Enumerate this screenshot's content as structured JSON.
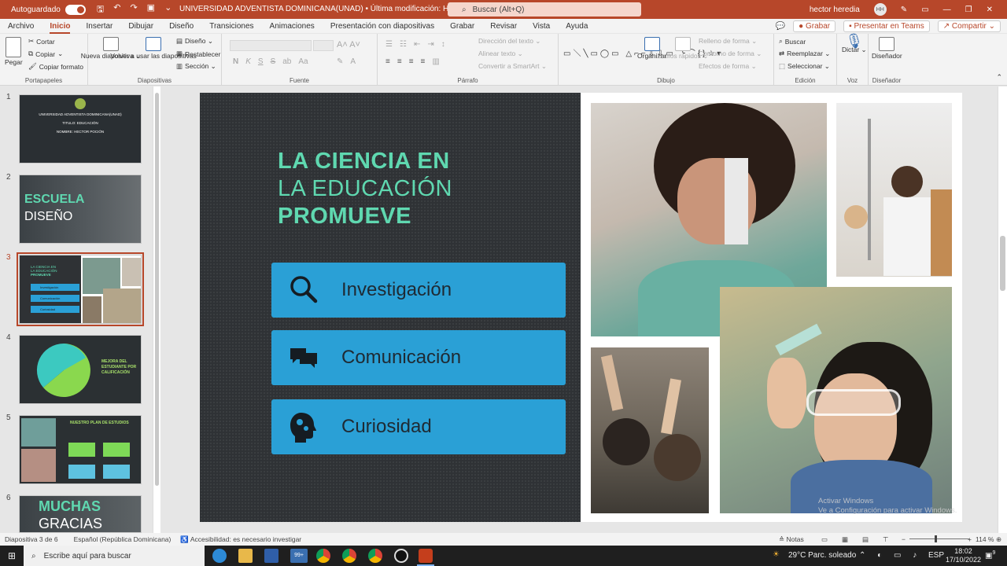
{
  "titlebar": {
    "autosave_label": "Autoguardado",
    "doc_title": "UNIVERSIDAD ADVENTISTA DOMINICANA(UNAD)  •  Última modificación: Hace 21 min ⌄",
    "search_placeholder": "Buscar (Alt+Q)",
    "user_name": "hector heredia",
    "user_initials": "HH"
  },
  "tabs": [
    "Archivo",
    "Inicio",
    "Insertar",
    "Dibujar",
    "Diseño",
    "Transiciones",
    "Animaciones",
    "Presentación con diapositivas",
    "Grabar",
    "Revisar",
    "Vista",
    "Ayuda"
  ],
  "active_tab": "Inicio",
  "tab_actions": {
    "grabar": "Grabar",
    "teams": "Presentar en Teams",
    "compartir": "Compartir"
  },
  "ribbon": {
    "portapapeles": {
      "label": "Portapapeles",
      "pegar": "Pegar",
      "cortar": "Cortar",
      "copiar": "Copiar",
      "copiar_formato": "Copiar formato"
    },
    "diapositivas": {
      "label": "Diapositivas",
      "nueva": "Nueva diapositiva ⌄",
      "volver": "Volver a usar las diapositivas",
      "diseno": "Diseño ⌄",
      "restablecer": "Restablecer",
      "seccion": "Sección ⌄"
    },
    "fuente": {
      "label": "Fuente"
    },
    "parrafo": {
      "label": "Párrafo",
      "direccion": "Dirección del texto ⌄",
      "alinear": "Alinear texto ⌄",
      "smartart": "Convertir a SmartArt ⌄"
    },
    "dibujo": {
      "label": "Dibujo",
      "organizar": "Organizar",
      "estilos": "Estilos rápidos ⌄",
      "relleno": "Relleno de forma ⌄",
      "contorno": "Contorno de forma ⌄",
      "efectos": "Efectos de forma ⌄"
    },
    "edicion": {
      "label": "Edición",
      "buscar": "Buscar",
      "reemplazar": "Reemplazar ⌄",
      "seleccionar": "Seleccionar ⌄"
    },
    "voz": {
      "label": "Voz",
      "dictar": "Dictar ⌄"
    },
    "disenador": {
      "label": "Diseñador",
      "disenador": "Diseñador"
    }
  },
  "thumbnails": [
    {
      "num": "1",
      "lines": [
        "UNIVERSIDAD ADVENTISTA DOMINICANA(UNAD)",
        "TITULO: EDUCACIÓN",
        "NOMBRE: HECTOR POCIÓN"
      ]
    },
    {
      "num": "2",
      "line1": "ESCUELA",
      "line2": "DISEÑO"
    },
    {
      "num": "3",
      "t1": "LA CIENCIA EN",
      "t2": "LA EDUCACIÓN",
      "t3": "PROMUEVE",
      "b1": "Investigación",
      "b2": "Comunicación",
      "b3": "Curiosidad"
    },
    {
      "num": "4",
      "text": "MEJORA DEL ESTUDIANTE POR CALIFICACIÓN"
    },
    {
      "num": "5",
      "title": "NUESTRO PLAN DE ESTUDIOS"
    },
    {
      "num": "6",
      "line1": "MUCHAS",
      "line2": "GRACIAS"
    }
  ],
  "slide": {
    "title_line1": "LA CIENCIA EN",
    "title_line2": "LA EDUCACIÓN",
    "title_line3": "PROMUEVE",
    "buttons": [
      {
        "label": "Investigación",
        "icon": "search-icon"
      },
      {
        "label": "Comunicación",
        "icon": "chat-bubbles-icon"
      },
      {
        "label": "Curiosidad",
        "icon": "head-gears-icon"
      }
    ]
  },
  "statusbar": {
    "slide_info": "Diapositiva 3 de 6",
    "language": "Español (República Dominicana)",
    "accessibility": "Accesibilidad: es necesario investigar",
    "notas": "Notas",
    "zoom": "114 %"
  },
  "watermark": {
    "line1": "Activar Windows",
    "line2": "Ve a Configuración para activar Windows."
  },
  "taskbar": {
    "search": "Escribe aquí para buscar",
    "weather": "29°C  Parc. soleado",
    "lang": "ESP",
    "time": "18:02",
    "date": "17/10/2022",
    "badge": "99+",
    "notif": "9"
  },
  "colors": {
    "accent": "#b7472a",
    "slide_title": "#5fd8b0",
    "slide_button": "#2aa0d6",
    "slide_bg": "#2f3235"
  }
}
